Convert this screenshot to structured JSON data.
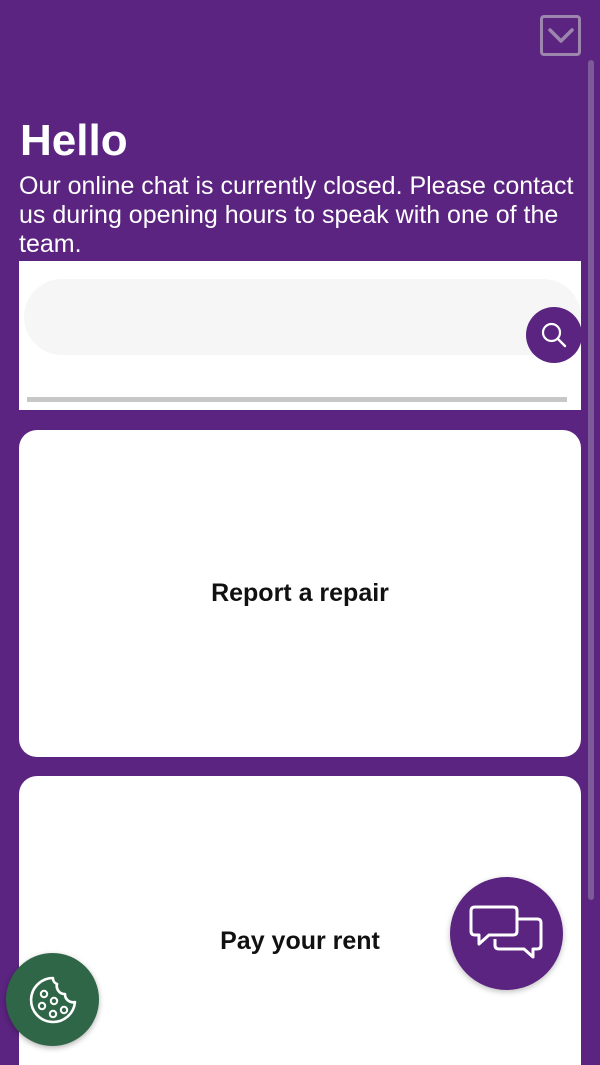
{
  "header": {
    "collapse_icon": "chevron-down-icon",
    "title": "Hello",
    "message": "Our online chat is currently closed. Please contact us during opening hours to speak with one of the team."
  },
  "search": {
    "value": "",
    "placeholder": "",
    "icon": "search-icon"
  },
  "cards": [
    {
      "label": "Report a repair"
    },
    {
      "label": "Pay your rent"
    }
  ],
  "floating": {
    "chat_icon": "chat-bubbles-icon",
    "cookie_icon": "cookie-icon"
  },
  "colors": {
    "brand": "#5b2480",
    "cookie_button": "#2f6647",
    "card_background": "#ffffff",
    "search_background": "#f6f6f6"
  }
}
